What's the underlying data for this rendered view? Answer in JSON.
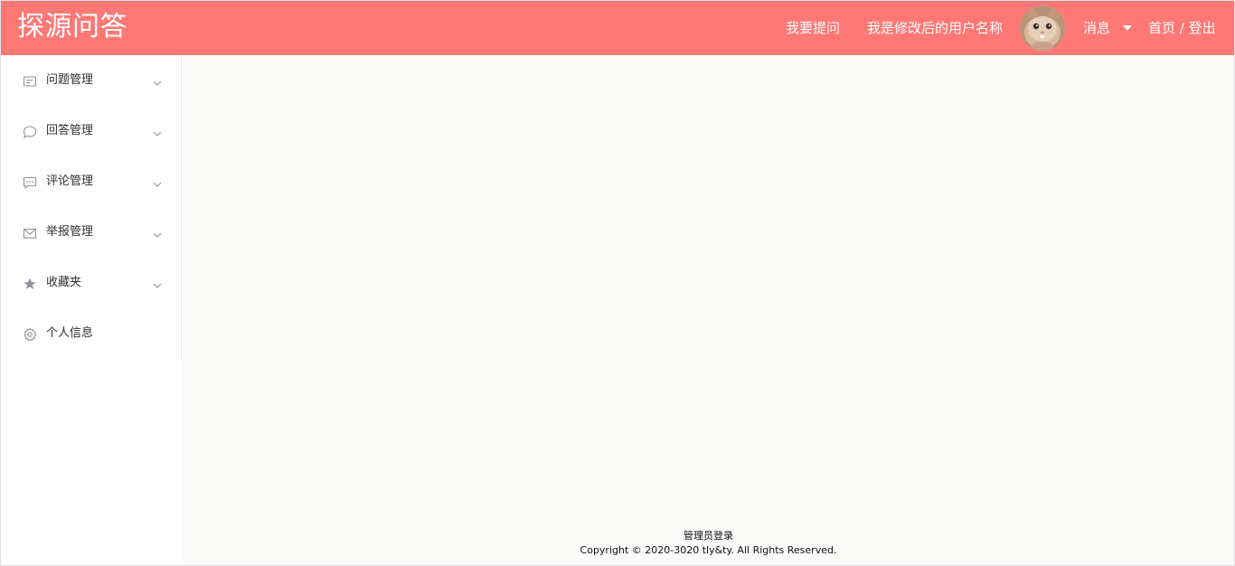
{
  "header": {
    "logo": "探源问答",
    "ask_question": "我要提问",
    "username": "我是修改后的用户名称",
    "messages": "消息",
    "home_logout": "首页 / 登出"
  },
  "sidebar": {
    "items": [
      {
        "label": "问题管理",
        "icon": "document-icon",
        "has_submenu": true
      },
      {
        "label": "回答管理",
        "icon": "chat-bubble-icon",
        "has_submenu": true
      },
      {
        "label": "评论管理",
        "icon": "comment-dots-icon",
        "has_submenu": true
      },
      {
        "label": "举报管理",
        "icon": "envelope-icon",
        "has_submenu": true
      },
      {
        "label": "收藏夹",
        "icon": "star-icon",
        "has_submenu": true
      },
      {
        "label": "个人信息",
        "icon": "gear-icon",
        "has_submenu": false
      }
    ]
  },
  "footer": {
    "admin_login": "管理员登录",
    "copyright": "Copyright © 2020-3020 tly&ty. All Rights Reserved."
  },
  "colors": {
    "header_bg": "#ff7875",
    "main_bg": "#fafbf8",
    "menu_text": "#303133",
    "icon_gray": "#909399"
  }
}
